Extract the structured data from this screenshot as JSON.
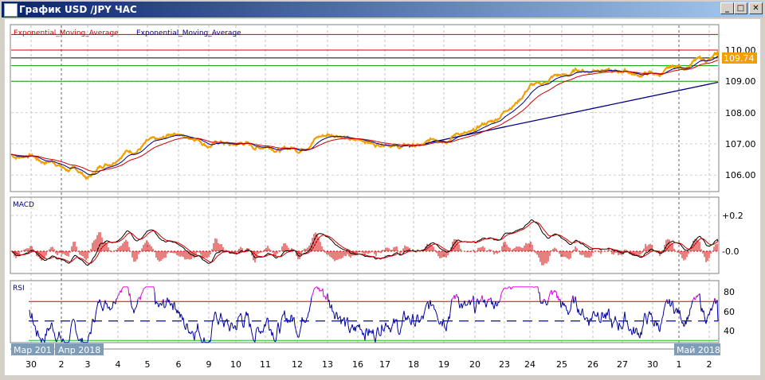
{
  "window": {
    "title": "График USD /JPY  ЧАС",
    "minimize": "_",
    "maximize": "□",
    "close": "✕"
  },
  "legend": {
    "ema1": "Exponential_Moving_Average",
    "ema2": "Exponential_Moving_Average"
  },
  "price_axis": {
    "ticks": [
      "110.00",
      "109.00",
      "108.00",
      "107.00",
      "106.00"
    ],
    "current_price": "109.74"
  },
  "macd": {
    "label": "MACD",
    "ticks": [
      "+0.2",
      "-0.0"
    ]
  },
  "rsi": {
    "label": "RSI",
    "ticks": [
      "80",
      "60",
      "40"
    ]
  },
  "months": {
    "mar": "Мар 201",
    "apr": "Апр 2018",
    "may": "Май 2018"
  },
  "dates": [
    "30",
    "2",
    "3",
    "4",
    "5",
    "6",
    "9",
    "10",
    "11",
    "12",
    "13",
    "16",
    "17",
    "18",
    "19",
    "20",
    "23",
    "24",
    "25",
    "26",
    "27",
    "30",
    "1",
    "2"
  ],
  "colors": {
    "price": "#f0a000",
    "ema_fast": "#000080",
    "ema_slow": "#d00000",
    "level_red": "#d00000",
    "level_green": "#00a000",
    "trend": "#000080",
    "rsi_high": "#e000e0"
  },
  "chart_data": {
    "type": "line",
    "title": "USD/JPY H1",
    "x": [
      "30",
      "2",
      "3",
      "4",
      "5",
      "6",
      "9",
      "10",
      "11",
      "12",
      "13",
      "16",
      "17",
      "18",
      "19",
      "20",
      "23",
      "24",
      "25",
      "26",
      "27",
      "30",
      "1",
      "2"
    ],
    "series": [
      {
        "name": "USD/JPY",
        "values": [
          106.6,
          106.3,
          105.95,
          106.6,
          107.0,
          107.35,
          107.0,
          107.0,
          106.9,
          106.8,
          107.35,
          107.1,
          107.0,
          106.9,
          107.2,
          107.4,
          108.0,
          108.8,
          109.2,
          109.4,
          109.3,
          109.2,
          109.45,
          109.74
        ]
      }
    ],
    "levels": {
      "red": [
        110.5,
        110.0
      ],
      "black": [
        109.75
      ],
      "green": [
        109.5,
        109.0
      ]
    },
    "trendline": {
      "from": {
        "x": "18",
        "y": 106.9
      },
      "to": {
        "x": "2",
        "y": 108.97
      }
    },
    "ylim": [
      105.7,
      110.8
    ],
    "macd_ylim": [
      -0.25,
      0.3
    ],
    "rsi_levels": [
      70,
      50,
      30
    ],
    "rsi_ylim": [
      25,
      90
    ]
  }
}
